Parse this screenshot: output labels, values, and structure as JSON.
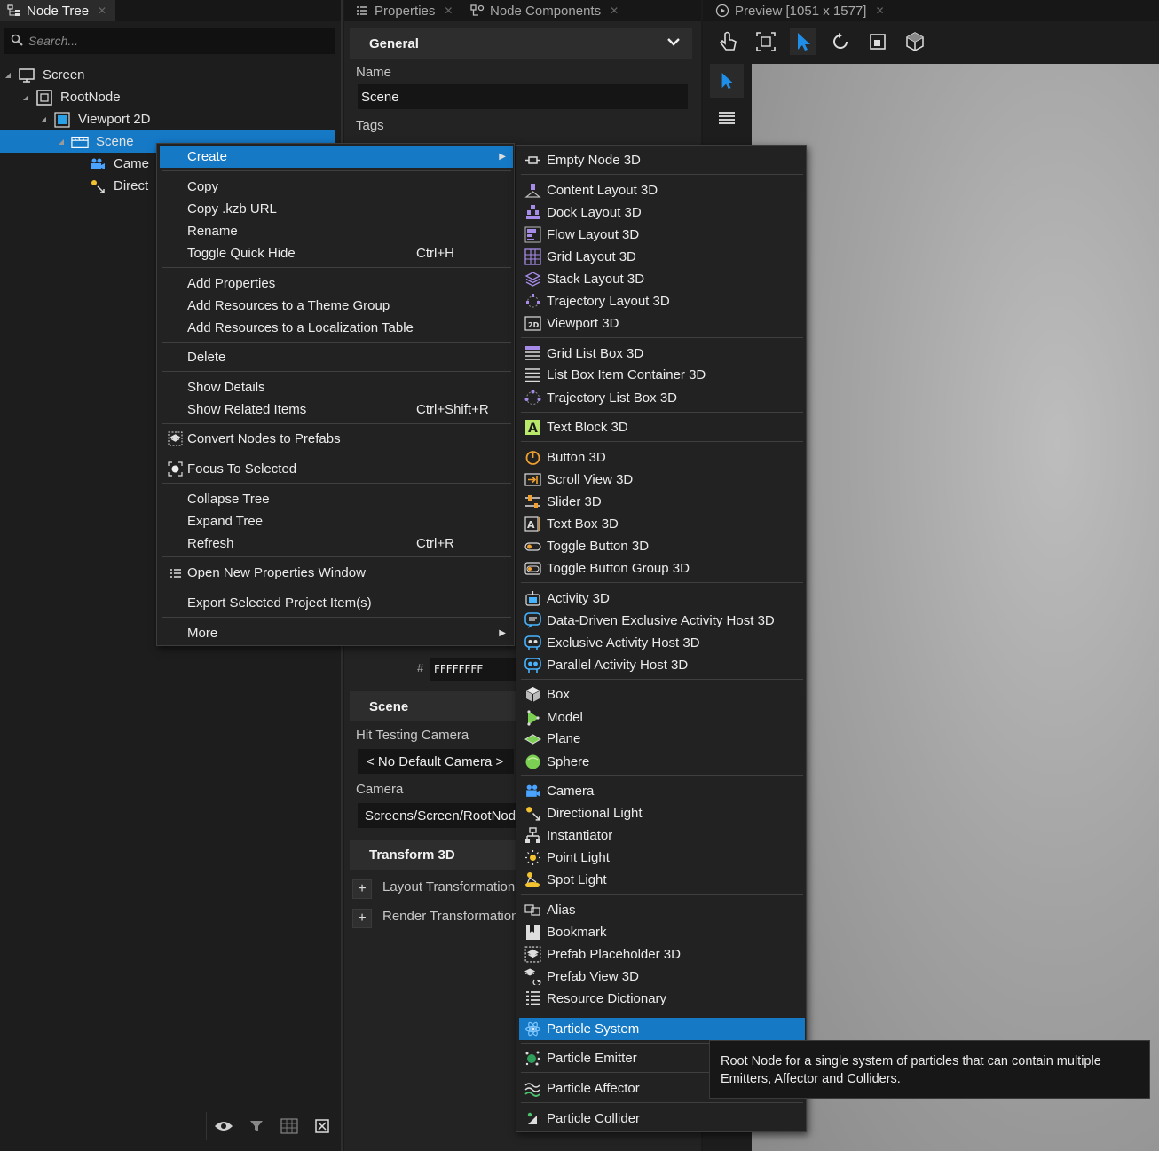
{
  "node_tree": {
    "tab_title": "Node Tree",
    "search_placeholder": "Search...",
    "nodes": [
      {
        "label": "Screen"
      },
      {
        "label": "RootNode"
      },
      {
        "label": "Viewport 2D"
      },
      {
        "label": "Scene"
      },
      {
        "label": "Came"
      },
      {
        "label": "Direct"
      }
    ]
  },
  "properties": {
    "tab_title": "Properties",
    "tab2_title": "Node Components",
    "general_header": "General",
    "name_label": "Name",
    "name_value": "Scene",
    "tags_label": "Tags",
    "color_hash": "#",
    "color_value": "FFFFFFFF",
    "scene_header": "Scene",
    "hit_testing_label": "Hit Testing Camera",
    "hit_testing_value": "< No Default Camera >",
    "camera_label": "Camera",
    "camera_value": "Screens/Screen/RootNode",
    "transform_header": "Transform 3D",
    "layout_transformation": "Layout Transformation",
    "render_transformation": "Render Transformation"
  },
  "preview": {
    "tab_title": "Preview [1051 x 1577]"
  },
  "context_menu": {
    "create": "Create",
    "copy": "Copy",
    "copy_kzb": "Copy .kzb URL",
    "rename": "Rename",
    "toggle_quick_hide": "Toggle Quick Hide",
    "toggle_quick_hide_shortcut": "Ctrl+H",
    "add_properties": "Add Properties",
    "add_to_theme": "Add Resources to a Theme Group",
    "add_to_localization": "Add Resources to a Localization Table",
    "delete": "Delete",
    "show_details": "Show Details",
    "show_related": "Show Related Items",
    "show_related_shortcut": "Ctrl+Shift+R",
    "convert_prefabs": "Convert Nodes to Prefabs",
    "focus_selected": "Focus To Selected",
    "collapse_tree": "Collapse Tree",
    "expand_tree": "Expand Tree",
    "refresh": "Refresh",
    "refresh_shortcut": "Ctrl+R",
    "open_properties_window": "Open New Properties Window",
    "export_selected": "Export Selected Project Item(s)",
    "more": "More"
  },
  "create_submenu": {
    "empty_node_3d": "Empty Node 3D",
    "content_layout_3d": "Content Layout 3D",
    "dock_layout_3d": "Dock Layout 3D",
    "flow_layout_3d": "Flow Layout 3D",
    "grid_layout_3d": "Grid Layout 3D",
    "stack_layout_3d": "Stack Layout 3D",
    "trajectory_layout_3d": "Trajectory Layout 3D",
    "viewport_3d": "Viewport 3D",
    "grid_list_box_3d": "Grid List Box 3D",
    "list_box_item_container_3d": "List Box Item Container 3D",
    "trajectory_list_box_3d": "Trajectory List Box 3D",
    "text_block_3d": "Text Block 3D",
    "button_3d": "Button 3D",
    "scroll_view_3d": "Scroll View 3D",
    "slider_3d": "Slider 3D",
    "text_box_3d": "Text Box 3D",
    "toggle_button_3d": "Toggle Button 3D",
    "toggle_button_group_3d": "Toggle Button Group 3D",
    "activity_3d": "Activity 3D",
    "data_driven_activity_host_3d": "Data-Driven Exclusive Activity Host 3D",
    "exclusive_activity_host_3d": "Exclusive Activity Host 3D",
    "parallel_activity_host_3d": "Parallel Activity Host 3D",
    "box": "Box",
    "model": "Model",
    "plane": "Plane",
    "sphere": "Sphere",
    "camera": "Camera",
    "directional_light": "Directional Light",
    "instantiator": "Instantiator",
    "point_light": "Point Light",
    "spot_light": "Spot Light",
    "alias": "Alias",
    "bookmark": "Bookmark",
    "prefab_placeholder_3d": "Prefab Placeholder 3D",
    "prefab_view_3d": "Prefab View 3D",
    "resource_dictionary": "Resource Dictionary",
    "particle_system": "Particle System",
    "particle_emitter": "Particle Emitter",
    "particle_affector": "Particle Affector",
    "particle_collider": "Particle Collider"
  },
  "tooltip": {
    "line1": "Root Node for a single system of particles that can contain multiple",
    "line2": "Emitters, Affector and Colliders."
  },
  "colors": {
    "accent_blue": "#1579c6",
    "panel_bg": "#232323",
    "menu_bg": "#222222"
  },
  "icons": {
    "selected_tool": "arrow-select-icon"
  }
}
